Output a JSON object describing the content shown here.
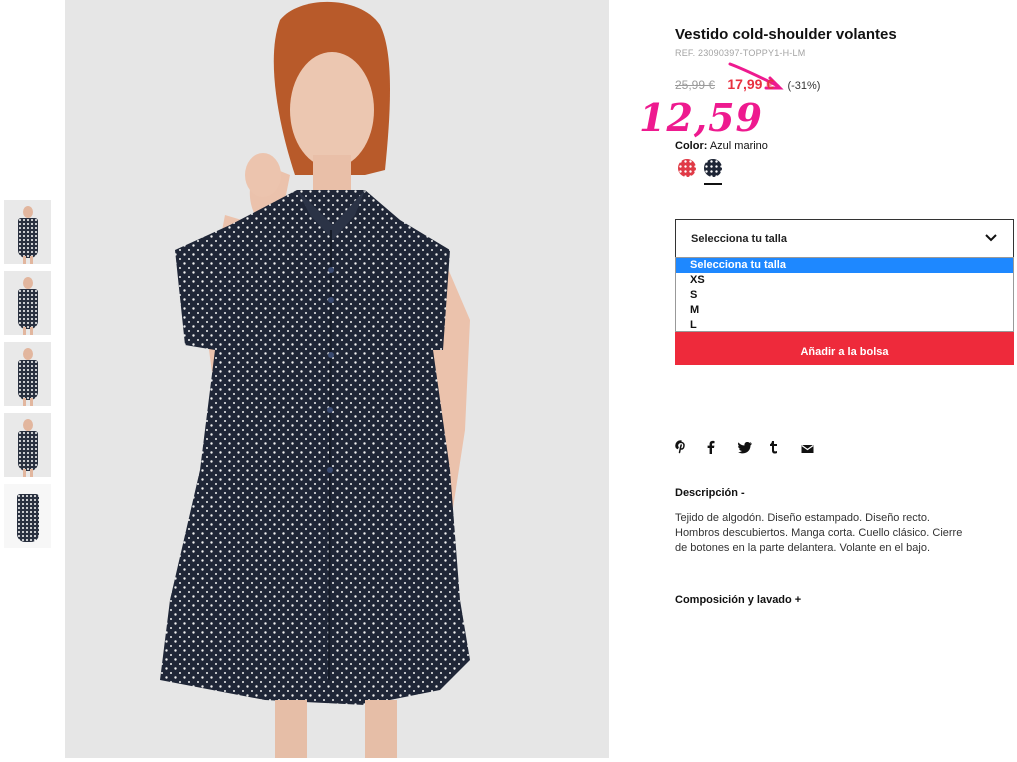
{
  "product": {
    "title": "Vestido cold-shoulder volantes",
    "ref": "REF. 23090397-TOPPY1-H-LM",
    "old_price": "25,99 €",
    "new_price": "17,99 €",
    "discount": "(-31%)",
    "handwritten_price": "12,59",
    "color_label": "Color:",
    "color_value": "Azul marino",
    "swatches": [
      {
        "name": "red-white-dots",
        "color": "#e03a46"
      },
      {
        "name": "navy-white-dots",
        "color": "#1e2535"
      }
    ]
  },
  "size_select": {
    "label": "Selecciona tu talla",
    "options": [
      "Selecciona tu talla",
      "XS",
      "S",
      "M",
      "L"
    ]
  },
  "buttons": {
    "add_to_bag": "Añadir a la bolsa"
  },
  "share_icons": [
    "pinterest-icon",
    "facebook-icon",
    "twitter-icon",
    "tumblr-icon",
    "mail-icon"
  ],
  "description": {
    "heading": "Descripción -",
    "body": "Tejido de algodón. Diseño estampado. Diseño recto. Hombros descubiertos. Manga corta. Cuello clásico. Cierre de botones en la parte delantera. Volante en el bajo."
  },
  "composition": {
    "heading": "Composición y lavado +"
  },
  "colors": {
    "accent_red": "#ee2a3b",
    "price_red": "#e8313f",
    "annotation_pink": "#ee1a8f",
    "select_blue": "#1e88ff"
  }
}
